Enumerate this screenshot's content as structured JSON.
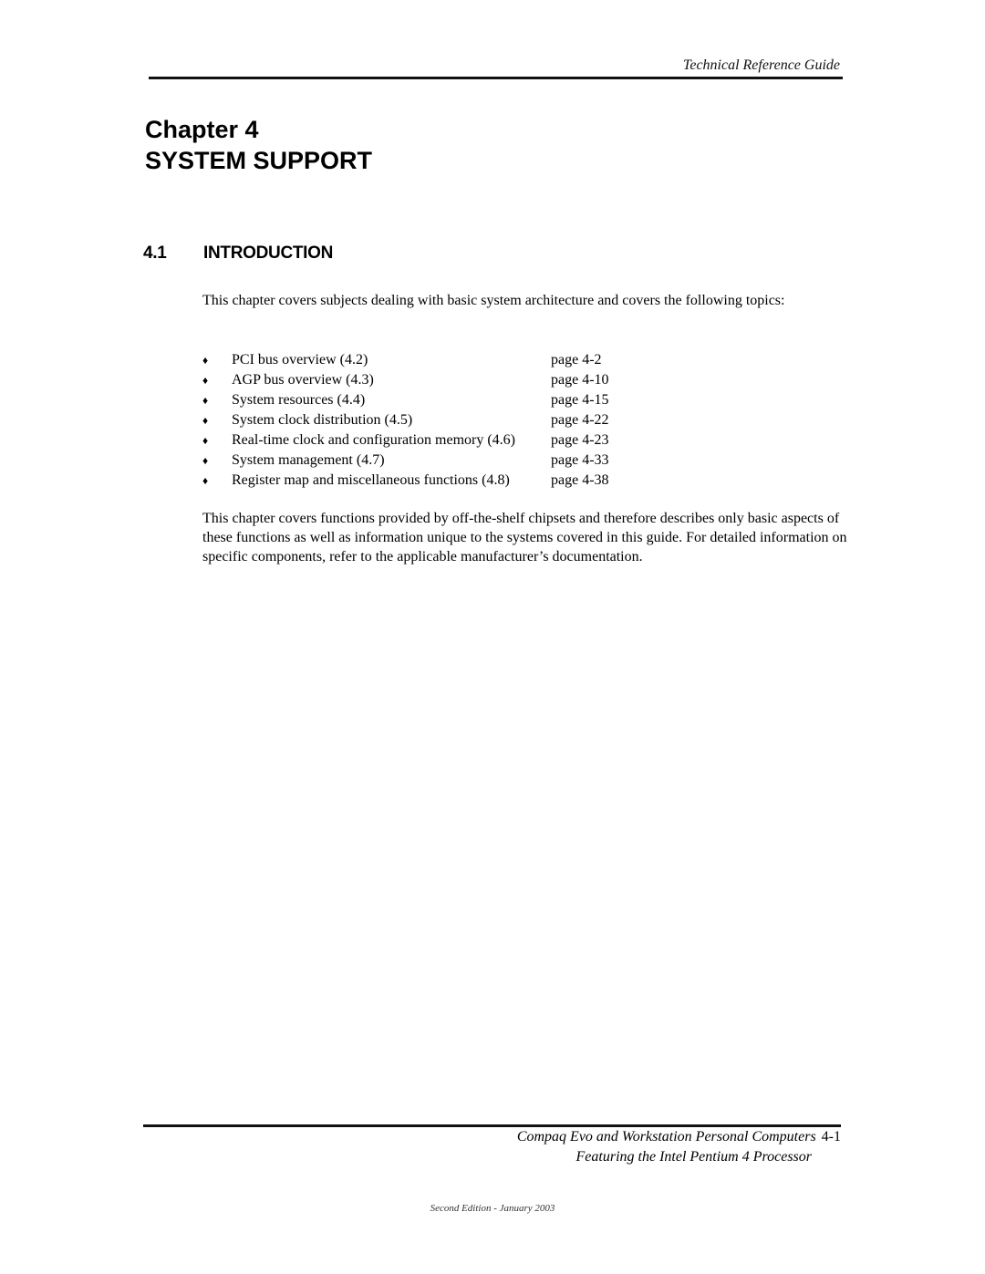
{
  "header": {
    "title": "Technical Reference Guide"
  },
  "chapter": {
    "label": "Chapter 4",
    "title": "SYSTEM SUPPORT"
  },
  "section": {
    "number": "4.1",
    "title": "INTRODUCTION"
  },
  "intro_paragraph": "This chapter covers subjects dealing with basic system architecture and covers the following topics:",
  "topics": {
    "bullet_icon": "diamond-bullet",
    "bullet_glyph": "♦",
    "items": [
      {
        "label": "PCI bus overview (4.2)",
        "page": "page 4-2"
      },
      {
        "label": "AGP bus overview (4.3)",
        "page": "page 4-10"
      },
      {
        "label": "System resources (4.4)",
        "page": "page 4-15"
      },
      {
        "label": "System clock distribution (4.5)",
        "page": "page 4-22"
      },
      {
        "label": "Real-time clock and configuration memory (4.6)",
        "page": "page 4-23"
      },
      {
        "label": "System management (4.7)",
        "page": "page 4-33"
      },
      {
        "label": "Register map and miscellaneous functions (4.8)",
        "page": "page 4-38"
      }
    ]
  },
  "closing_paragraph": "This chapter covers functions provided by off-the-shelf chipsets and therefore describes only basic aspects of these functions as well as information unique to the systems covered in this guide. For detailed information on specific components, refer to the applicable manufacturer’s documentation.",
  "footer": {
    "line1": "Compaq Evo and Workstation Personal Computers",
    "page_number": "4-1",
    "line2": "Featuring the Intel Pentium 4 Processor",
    "edition": "Second Edition - January 2003"
  }
}
